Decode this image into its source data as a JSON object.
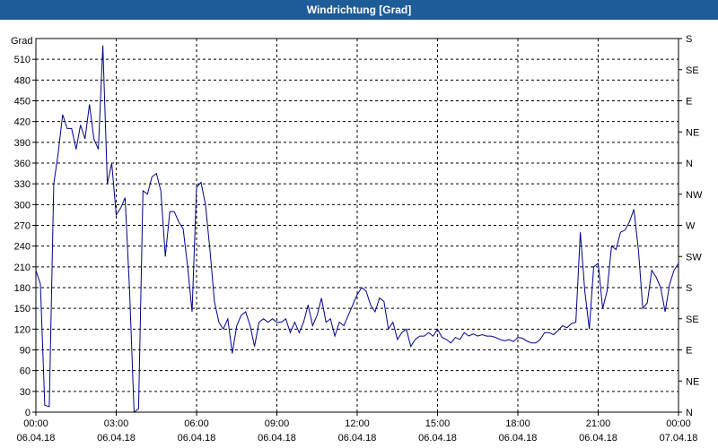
{
  "chart_data": {
    "type": "line",
    "title": "Windrichtung [Grad]",
    "ylabel": "Grad",
    "ylim": [
      0,
      540
    ],
    "yticks": [
      0,
      30,
      60,
      90,
      120,
      150,
      180,
      210,
      240,
      270,
      300,
      330,
      360,
      390,
      420,
      450,
      480,
      510
    ],
    "right_ticks": [
      "N",
      "NE",
      "E",
      "SE",
      "S",
      "SW",
      "W",
      "NW",
      "N",
      "NE",
      "E",
      "SE",
      "S"
    ],
    "grid": true,
    "x_ticks": [
      {
        "time": "00:00",
        "date": "06.04.18"
      },
      {
        "time": "03:00",
        "date": "06.04.18"
      },
      {
        "time": "06:00",
        "date": "06.04.18"
      },
      {
        "time": "09:00",
        "date": "06.04.18"
      },
      {
        "time": "12:00",
        "date": "06.04.18"
      },
      {
        "time": "15:00",
        "date": "06.04.18"
      },
      {
        "time": "18:00",
        "date": "06.04.18"
      },
      {
        "time": "21:00",
        "date": "06.04.18"
      },
      {
        "time": "00:00",
        "date": "07.04.18"
      }
    ],
    "series": [
      {
        "color": "#00008b",
        "points": [
          [
            "00:00",
            205
          ],
          [
            "00:10",
            185
          ],
          [
            "00:20",
            10
          ],
          [
            "00:30",
            8
          ],
          [
            "00:40",
            330
          ],
          [
            "00:50",
            375
          ],
          [
            "01:00",
            430
          ],
          [
            "01:10",
            410
          ],
          [
            "01:20",
            410
          ],
          [
            "01:30",
            380
          ],
          [
            "01:40",
            415
          ],
          [
            "01:50",
            395
          ],
          [
            "02:00",
            445
          ],
          [
            "02:10",
            395
          ],
          [
            "02:20",
            380
          ],
          [
            "02:30",
            530
          ],
          [
            "02:40",
            330
          ],
          [
            "02:50",
            360
          ],
          [
            "03:00",
            285
          ],
          [
            "03:10",
            295
          ],
          [
            "03:20",
            310
          ],
          [
            "03:30",
            175
          ],
          [
            "03:40",
            0
          ],
          [
            "03:50",
            5
          ],
          [
            "04:00",
            320
          ],
          [
            "04:10",
            315
          ],
          [
            "04:20",
            340
          ],
          [
            "04:30",
            345
          ],
          [
            "04:40",
            320
          ],
          [
            "04:50",
            225
          ],
          [
            "05:00",
            290
          ],
          [
            "05:10",
            290
          ],
          [
            "05:20",
            275
          ],
          [
            "05:30",
            265
          ],
          [
            "05:40",
            210
          ],
          [
            "05:50",
            145
          ],
          [
            "06:00",
            325
          ],
          [
            "06:10",
            332
          ],
          [
            "06:20",
            300
          ],
          [
            "06:30",
            235
          ],
          [
            "06:40",
            160
          ],
          [
            "06:50",
            130
          ],
          [
            "07:00",
            120
          ],
          [
            "07:10",
            135
          ],
          [
            "07:20",
            85
          ],
          [
            "07:30",
            125
          ],
          [
            "07:40",
            140
          ],
          [
            "07:50",
            145
          ],
          [
            "08:00",
            125
          ],
          [
            "08:10",
            95
          ],
          [
            "08:20",
            130
          ],
          [
            "08:30",
            135
          ],
          [
            "08:40",
            130
          ],
          [
            "08:50",
            135
          ],
          [
            "09:00",
            130
          ],
          [
            "09:10",
            130
          ],
          [
            "09:20",
            135
          ],
          [
            "09:30",
            115
          ],
          [
            "09:40",
            130
          ],
          [
            "09:50",
            115
          ],
          [
            "10:00",
            130
          ],
          [
            "10:10",
            155
          ],
          [
            "10:20",
            125
          ],
          [
            "10:30",
            140
          ],
          [
            "10:40",
            165
          ],
          [
            "10:50",
            130
          ],
          [
            "11:00",
            135
          ],
          [
            "11:10",
            110
          ],
          [
            "11:20",
            130
          ],
          [
            "11:30",
            125
          ],
          [
            "11:40",
            140
          ],
          [
            "11:50",
            155
          ],
          [
            "12:00",
            170
          ],
          [
            "12:10",
            180
          ],
          [
            "12:20",
            175
          ],
          [
            "12:30",
            155
          ],
          [
            "12:40",
            145
          ],
          [
            "12:50",
            165
          ],
          [
            "13:00",
            160
          ],
          [
            "13:10",
            120
          ],
          [
            "13:20",
            130
          ],
          [
            "13:30",
            105
          ],
          [
            "13:40",
            115
          ],
          [
            "13:50",
            120
          ],
          [
            "14:00",
            95
          ],
          [
            "14:10",
            105
          ],
          [
            "14:20",
            110
          ],
          [
            "14:30",
            110
          ],
          [
            "14:40",
            115
          ],
          [
            "14:50",
            110
          ],
          [
            "15:00",
            120
          ],
          [
            "15:10",
            108
          ],
          [
            "15:20",
            105
          ],
          [
            "15:30",
            100
          ],
          [
            "15:40",
            108
          ],
          [
            "15:50",
            105
          ],
          [
            "16:00",
            115
          ],
          [
            "16:10",
            110
          ],
          [
            "16:20",
            113
          ],
          [
            "16:30",
            110
          ],
          [
            "16:40",
            112
          ],
          [
            "16:50",
            110
          ],
          [
            "17:00",
            110
          ],
          [
            "17:10",
            108
          ],
          [
            "17:20",
            105
          ],
          [
            "17:30",
            103
          ],
          [
            "17:40",
            105
          ],
          [
            "17:50",
            102
          ],
          [
            "18:00",
            108
          ],
          [
            "18:10",
            107
          ],
          [
            "18:20",
            103
          ],
          [
            "18:30",
            100
          ],
          [
            "18:40",
            100
          ],
          [
            "18:50",
            105
          ],
          [
            "19:00",
            115
          ],
          [
            "19:10",
            115
          ],
          [
            "19:20",
            112
          ],
          [
            "19:30",
            118
          ],
          [
            "19:40",
            125
          ],
          [
            "19:50",
            122
          ],
          [
            "20:00",
            128
          ],
          [
            "20:10",
            130
          ],
          [
            "20:20",
            260
          ],
          [
            "20:30",
            175
          ],
          [
            "20:40",
            120
          ],
          [
            "20:50",
            210
          ],
          [
            "21:00",
            215
          ],
          [
            "21:10",
            150
          ],
          [
            "21:20",
            175
          ],
          [
            "21:30",
            240
          ],
          [
            "21:40",
            235
          ],
          [
            "21:50",
            260
          ],
          [
            "22:00",
            263
          ],
          [
            "22:10",
            275
          ],
          [
            "22:20",
            293
          ],
          [
            "22:30",
            235
          ],
          [
            "22:40",
            150
          ],
          [
            "22:50",
            158
          ],
          [
            "23:00",
            205
          ],
          [
            "23:10",
            195
          ],
          [
            "23:20",
            180
          ],
          [
            "23:30",
            145
          ],
          [
            "23:40",
            185
          ],
          [
            "23:50",
            205
          ],
          [
            "24:00",
            215
          ]
        ]
      }
    ]
  }
}
